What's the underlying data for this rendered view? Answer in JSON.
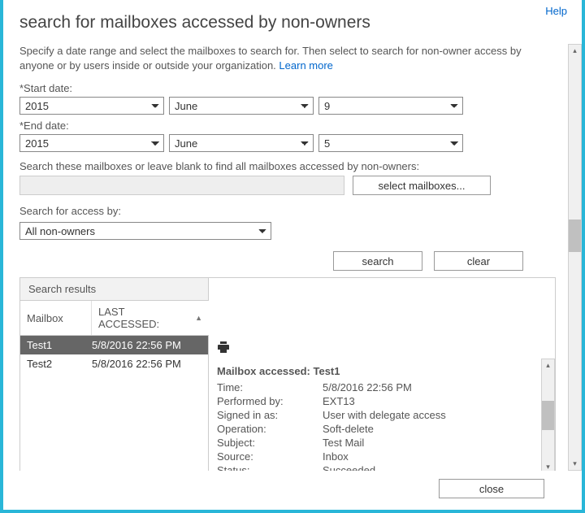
{
  "help_label": "Help",
  "title": "search for mailboxes accessed by non-owners",
  "intro_text": "Specify a date range and select the mailboxes to search for. Then select to search for non-owner access by anyone or by users inside or outside your organization.",
  "learn_more": "Learn more",
  "start_date_label": "*Start date:",
  "end_date_label": "*End date:",
  "start": {
    "year": "2015",
    "month": "June",
    "day": "9"
  },
  "end": {
    "year": "2015",
    "month": "June",
    "day": "5"
  },
  "mailbox_filter_label": "Search these mailboxes or leave blank to find all mailboxes accessed by non-owners:",
  "select_mailboxes_btn": "select mailboxes...",
  "access_by_label": "Search for access by:",
  "access_by_value": "All non-owners",
  "search_btn": "search",
  "clear_btn": "clear",
  "close_btn": "close",
  "results_header": "Search results",
  "col_mailbox": "Mailbox",
  "col_last": "LAST ACCESSED:",
  "rows": [
    {
      "mailbox": "Test1",
      "last": "5/8/2016 22:56 PM"
    },
    {
      "mailbox": "Test2",
      "last": "5/8/2016 22:56 PM"
    }
  ],
  "detail": {
    "title": "Mailbox accessed: Test1",
    "fields": [
      {
        "k": "Time:",
        "v": "5/8/2016 22:56 PM"
      },
      {
        "k": "Performed by:",
        "v": "EXT13"
      },
      {
        "k": "Signed in as:",
        "v": "User with delegate access"
      },
      {
        "k": "Operation:",
        "v": "Soft-delete"
      },
      {
        "k": "Subject:",
        "v": "Test Mail"
      },
      {
        "k": "Source:",
        "v": "Inbox"
      },
      {
        "k": "Status:",
        "v": "Succeeded"
      }
    ]
  }
}
